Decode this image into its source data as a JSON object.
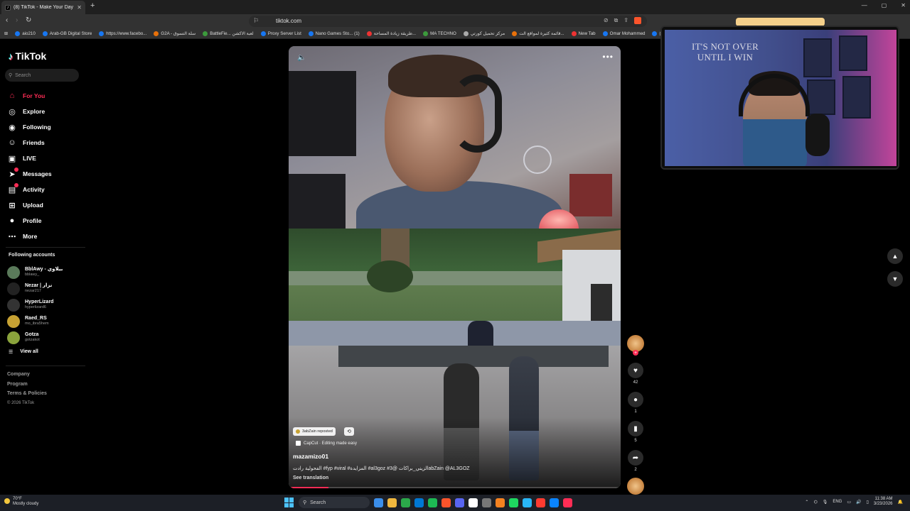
{
  "browser": {
    "tab_title": "(8) TikTok - Make Your Day",
    "tab_close": "✕",
    "new_tab": "+",
    "url": "tiktok.com",
    "window_controls": [
      "—",
      "▢",
      "✕"
    ],
    "bookmarks": [
      {
        "label": "aio210",
        "icon": "facebook-icon",
        "color": "#1877f2"
      },
      {
        "label": "Arab-GB Digital Store",
        "icon": "facebook-icon",
        "color": "#1877f2"
      },
      {
        "label": "https://www.facebo...",
        "icon": "facebook-icon",
        "color": "#1877f2"
      },
      {
        "label": "G2A - سلة التسوق",
        "icon": "g2a-icon",
        "color": "#e8710a"
      },
      {
        "label": "BattleFie... لعبة الاكشن",
        "icon": "check-icon",
        "color": "#3c9a3c"
      },
      {
        "label": "Proxy Server List",
        "icon": "facebook-icon",
        "color": "#1877f2"
      },
      {
        "label": "Nano Games Sto... (1)",
        "icon": "facebook-icon",
        "color": "#1877f2"
      },
      {
        "label": "طريقة زيادة المساحة...",
        "icon": "youtube-icon",
        "color": "#ee3333"
      },
      {
        "label": "MA TECHNO",
        "icon": "globe-icon",
        "color": "#3c9a3c"
      },
      {
        "label": "مركز تحميل كورتي",
        "icon": "person-icon",
        "color": "#aaaaaa"
      },
      {
        "label": "قائمة كثيرة لمواقع الت...",
        "icon": "bookmark-icon",
        "color": "#e8710a"
      },
      {
        "label": "New Tab",
        "icon": "brave-icon",
        "color": "#ee3333"
      },
      {
        "label": "Omar Mohammed",
        "icon": "facebook-icon",
        "color": "#1877f2"
      },
      {
        "label": "(1) أنوني",
        "icon": "facebook-icon",
        "color": "#1877f2"
      }
    ]
  },
  "sidebar": {
    "logo": "TikTok",
    "search_placeholder": "Search",
    "nav": [
      {
        "label": "For You",
        "icon": "home-icon",
        "glyph": "⌂",
        "active": true
      },
      {
        "label": "Explore",
        "icon": "compass-icon",
        "glyph": "◎",
        "active": false
      },
      {
        "label": "Following",
        "icon": "following-icon",
        "glyph": "◉",
        "active": false
      },
      {
        "label": "Friends",
        "icon": "friends-icon",
        "glyph": "☺",
        "active": false
      },
      {
        "label": "LIVE",
        "icon": "live-icon",
        "glyph": "▣",
        "active": false
      },
      {
        "label": "Messages",
        "icon": "send-icon",
        "glyph": "➤",
        "active": false,
        "badge": true
      },
      {
        "label": "Activity",
        "icon": "activity-icon",
        "glyph": "▤",
        "active": false,
        "badge": true
      },
      {
        "label": "Upload",
        "icon": "upload-icon",
        "glyph": "⊞",
        "active": false
      },
      {
        "label": "Profile",
        "icon": "profile-icon",
        "glyph": "●",
        "active": false
      },
      {
        "label": "More",
        "icon": "more-icon",
        "glyph": "⋯",
        "active": false
      }
    ],
    "following_heading": "Following accounts",
    "following": [
      {
        "name": "BblAwy - بيلاوي",
        "handle": "bblawy_",
        "color": "#5a7a5a"
      },
      {
        "name": "Nezar | نزار",
        "handle": "nezar217",
        "color": "#222222"
      },
      {
        "name": "HyperLizard",
        "handle": "hyperlizard6",
        "color": "#333333"
      },
      {
        "name": "Raed_RS",
        "handle": "mo_ibra5hem",
        "color": "#c7a233"
      },
      {
        "name": "Gotza",
        "handle": "gotzakot",
        "color": "#8aa33c"
      }
    ],
    "view_all": "View all",
    "footer": [
      "Company",
      "Program",
      "Terms & Policies"
    ],
    "copyright": "© 2026 TikTok"
  },
  "video": {
    "repost_label": "3abZain reposted",
    "effect_label": "CapCut · Editing made easy",
    "author": "mazamizo01",
    "caption": "الفحولية رادت #fyp #viral #المزايدة #al3goz #الزيني_براكات @3abZain @AL3GOZ",
    "see_translation": "See translation",
    "progress": 0.12,
    "more_glyph": "•••",
    "volume_glyph": "🔈"
  },
  "actions": {
    "like_count": "42",
    "comment_count": "1",
    "save_count": "5",
    "share_count": "2"
  },
  "webcam": {
    "banner_text": "IT'S NOT OVER UNTIL I WIN"
  },
  "taskbar": {
    "temperature": "70°F",
    "weather": "Mostly cloudy",
    "search_placeholder": "Search",
    "language": "ENG",
    "time": "11:38 AM",
    "date": "3/23/2026",
    "app_colors": [
      "#3b8eea",
      "#f0b73e",
      "#2ba84a",
      "#0078d4",
      "#1db954",
      "#fb542b",
      "#5865f2",
      "#ffffff",
      "#777777",
      "#f58220",
      "#1ed760",
      "#29b6f6",
      "#ff3b30",
      "#0a84ff",
      "#ff2d55"
    ]
  }
}
